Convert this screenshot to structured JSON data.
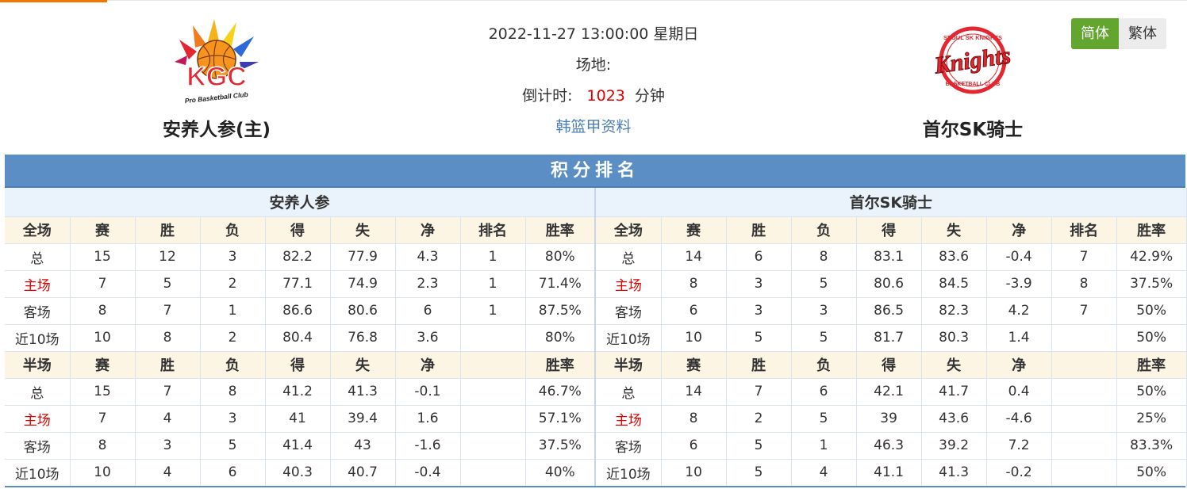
{
  "colors": {
    "accent": "#f07800",
    "section_bg": "#5b8ec4",
    "head_bg": "#fdf5e4",
    "team_head_bg": "#eaf3fb",
    "red": "#e00000",
    "green": "#62a630",
    "link": "#4a7fb5"
  },
  "home": {
    "name": "安养人参(主)",
    "logo_icon": "kgc-logo"
  },
  "away": {
    "name": "首尔SK骑士",
    "logo_icon": "knights-logo"
  },
  "match": {
    "datetime": "2022-11-27 13:00:00 星期日",
    "venue_label": "场地:",
    "countdown_label": "倒计时:",
    "countdown_value": "1023",
    "countdown_unit": "分钟",
    "league_link": "韩篮甲资料"
  },
  "lang": {
    "simplified": "简体",
    "traditional": "繁体"
  },
  "section_title": "积分排名",
  "left_table": {
    "team": "安养人参",
    "full_head": [
      "全场",
      "赛",
      "胜",
      "负",
      "得",
      "失",
      "净",
      "排名",
      "胜率"
    ],
    "full_rows": [
      [
        "总",
        "15",
        "12",
        "3",
        "82.2",
        "77.9",
        "4.3",
        "1",
        "80%"
      ],
      [
        "主场",
        "7",
        "5",
        "2",
        "77.1",
        "74.9",
        "2.3",
        "1",
        "71.4%"
      ],
      [
        "客场",
        "8",
        "7",
        "1",
        "86.6",
        "80.6",
        "6",
        "1",
        "87.5%"
      ],
      [
        "近10场",
        "10",
        "8",
        "2",
        "80.4",
        "76.8",
        "3.6",
        "",
        "80%"
      ]
    ],
    "half_head": [
      "半场",
      "赛",
      "胜",
      "负",
      "得",
      "失",
      "净",
      "",
      "胜率"
    ],
    "half_rows": [
      [
        "总",
        "15",
        "7",
        "8",
        "41.2",
        "41.3",
        "-0.1",
        "",
        "46.7%"
      ],
      [
        "主场",
        "7",
        "4",
        "3",
        "41",
        "39.4",
        "1.6",
        "",
        "57.1%"
      ],
      [
        "客场",
        "8",
        "3",
        "5",
        "41.4",
        "43",
        "-1.6",
        "",
        "37.5%"
      ],
      [
        "近10场",
        "10",
        "4",
        "6",
        "40.3",
        "40.7",
        "-0.4",
        "",
        "40%"
      ]
    ]
  },
  "right_table": {
    "team": "首尔SK骑士",
    "full_head": [
      "全场",
      "赛",
      "胜",
      "负",
      "得",
      "失",
      "净",
      "排名",
      "胜率"
    ],
    "full_rows": [
      [
        "总",
        "14",
        "6",
        "8",
        "83.1",
        "83.6",
        "-0.4",
        "7",
        "42.9%"
      ],
      [
        "主场",
        "8",
        "3",
        "5",
        "80.6",
        "84.5",
        "-3.9",
        "8",
        "37.5%"
      ],
      [
        "客场",
        "6",
        "3",
        "3",
        "86.5",
        "82.3",
        "4.2",
        "7",
        "50%"
      ],
      [
        "近10场",
        "10",
        "5",
        "5",
        "81.7",
        "80.3",
        "1.4",
        "",
        "50%"
      ]
    ],
    "half_head": [
      "半场",
      "赛",
      "胜",
      "负",
      "得",
      "失",
      "净",
      "",
      "胜率"
    ],
    "half_rows": [
      [
        "总",
        "14",
        "7",
        "6",
        "42.1",
        "41.7",
        "0.4",
        "",
        "50%"
      ],
      [
        "主场",
        "8",
        "2",
        "5",
        "39",
        "43.6",
        "-4.6",
        "",
        "25%"
      ],
      [
        "客场",
        "6",
        "5",
        "1",
        "46.3",
        "39.2",
        "7.2",
        "",
        "83.3%"
      ],
      [
        "近10场",
        "10",
        "5",
        "4",
        "41.1",
        "41.3",
        "-0.2",
        "",
        "50%"
      ]
    ]
  }
}
